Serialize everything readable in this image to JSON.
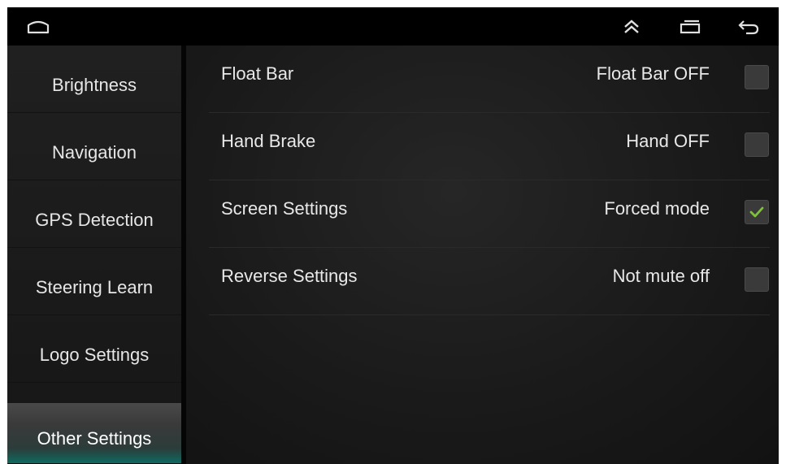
{
  "status_bar": {
    "icons": [
      "home-icon",
      "expand-up-icon",
      "recent-apps-icon",
      "back-icon"
    ]
  },
  "sidebar": {
    "items": [
      {
        "label": "Brightness"
      },
      {
        "label": "Navigation"
      },
      {
        "label": "GPS Detection"
      },
      {
        "label": "Steering Learn"
      },
      {
        "label": "Logo Settings"
      },
      {
        "label": "Other Settings",
        "active": true
      }
    ]
  },
  "settings": {
    "rows": [
      {
        "label": "Float Bar",
        "value": "Float Bar OFF",
        "checked": false
      },
      {
        "label": "Hand Brake",
        "value": "Hand OFF",
        "checked": false
      },
      {
        "label": "Screen Settings",
        "value": "Forced mode",
        "checked": true
      },
      {
        "label": "Reverse Settings",
        "value": "Not mute off",
        "checked": false
      }
    ]
  },
  "colors": {
    "check_mark": "#7fc23a",
    "active_accent": "#0f6a60",
    "text": "#e8e8e8"
  }
}
